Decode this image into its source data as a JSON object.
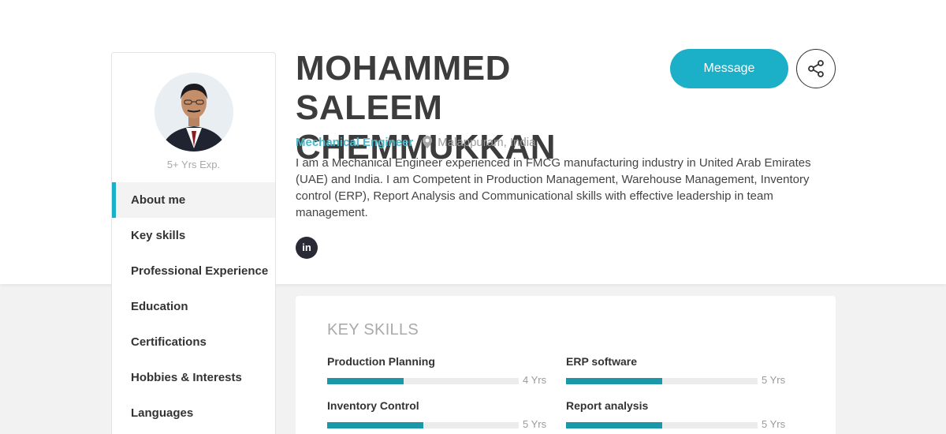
{
  "profile": {
    "name": "MOHAMMED SALEEM CHEMMUKKAN",
    "experience": "5+ Yrs Exp.",
    "job_title": "Mechanical Engineer",
    "location": "Malappuram, India",
    "about": "I am a Mechanical Engineer experienced in FMCG manufacturing industry in United Arab Emirates (UAE) and India. I am Competent in Production Management, Warehouse Management, Inventory control (ERP), Report Analysis and Communicational skills with effective leadership in team management.",
    "social": {
      "linkedin_label": "in"
    }
  },
  "actions": {
    "message_label": "Message",
    "share_icon": "share-icon"
  },
  "sidebar": {
    "items": [
      {
        "label": "About me",
        "active": true
      },
      {
        "label": "Key skills",
        "active": false
      },
      {
        "label": "Professional Experience",
        "active": false
      },
      {
        "label": "Education",
        "active": false
      },
      {
        "label": "Certifications",
        "active": false
      },
      {
        "label": "Hobbies & Interests",
        "active": false
      },
      {
        "label": "Languages",
        "active": false
      }
    ]
  },
  "skills": {
    "heading": "KEY SKILLS",
    "items": [
      {
        "name": "Production Planning",
        "years_label": "4 Yrs",
        "level": 0.4
      },
      {
        "name": "ERP software",
        "years_label": "5 Yrs",
        "level": 0.5
      },
      {
        "name": "Inventory Control",
        "years_label": "5 Yrs",
        "level": 0.5
      },
      {
        "name": "Report analysis",
        "years_label": "5 Yrs",
        "level": 0.5
      }
    ]
  },
  "colors": {
    "accent": "#1cb0c8",
    "bar": "#1a98a8",
    "linkedin": "#2a2a36"
  }
}
